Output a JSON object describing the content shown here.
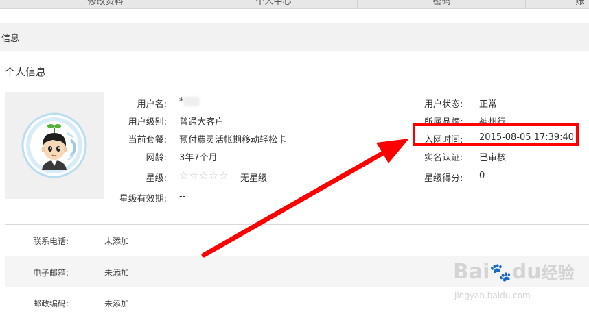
{
  "tabs": [
    {
      "label": "修改资料"
    },
    {
      "label": "个人中心"
    },
    {
      "label": "密码"
    },
    {
      "label": "账"
    }
  ],
  "section_title": "信息",
  "page_heading": "个人信息",
  "profile_left": {
    "username_label": "用户名:",
    "username_value": "*",
    "level_label": "用户级别:",
    "level_value": "普通大客户",
    "plan_label": "当前套餐:",
    "plan_value": "预付费灵活帐期移动轻松卡",
    "age_label": "网龄:",
    "age_value": "3年7个月",
    "star_label": "星级:",
    "star_rating": 0,
    "star_total": 5,
    "star_value": "无星级",
    "star_expiry_label": "星级有效期:",
    "star_expiry_value": "--"
  },
  "profile_right": {
    "status_label": "用户状态:",
    "status_value": "正常",
    "brand_label": "所属品牌:",
    "brand_value": "神州行",
    "join_time_label": "入网时间:",
    "join_time_value": "2015-08-05 17:39:40",
    "realname_label": "实名认证:",
    "realname_value": "已审核",
    "score_label": "星级得分:",
    "score_value": "0"
  },
  "contacts": [
    {
      "label": "联系电话:",
      "value": "未添加"
    },
    {
      "label": "电子邮箱:",
      "value": "未添加"
    },
    {
      "label": "邮政编码:",
      "value": "未添加"
    }
  ],
  "annotation_color": "#ff0000",
  "watermark": {
    "main_text": "Bai",
    "logo_text": "du",
    "suffix_text": "经验",
    "url": "jingyan.baidu.com"
  }
}
